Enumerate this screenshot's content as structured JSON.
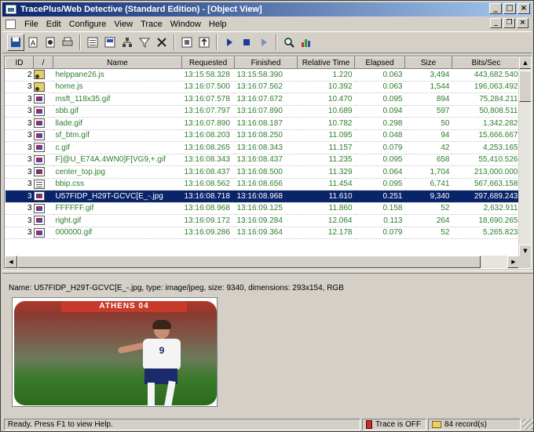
{
  "window": {
    "title": "TracePlus/Web Detective (Standard Edition) - [Object View]",
    "minimize": "_",
    "maximize": "□",
    "close": "×"
  },
  "menu": [
    "File",
    "Edit",
    "Configure",
    "View",
    "Trace",
    "Window",
    "Help"
  ],
  "mdi": {
    "minimize": "_",
    "restore": "❐",
    "close": "×"
  },
  "columns": [
    "ID",
    "/",
    "Name",
    "Requested",
    "Finished",
    "Relative Time",
    "Elapsed",
    "Size",
    "Bits/Sec"
  ],
  "rows": [
    {
      "id": "2",
      "icon": "js-icon",
      "type": "js",
      "name": "helppane26.js",
      "requested": "13:15:58.328",
      "finished": "13:15:58.390",
      "relative": "1.220",
      "elapsed": "0.063",
      "size": "3,494",
      "bps": "443,682.540"
    },
    {
      "id": "3",
      "icon": "js-icon",
      "type": "js",
      "name": "home.js",
      "requested": "13:16:07.500",
      "finished": "13:16:07.562",
      "relative": "10.392",
      "elapsed": "0.063",
      "size": "1,544",
      "bps": "196,063.492"
    },
    {
      "id": "3",
      "icon": "gif-icon",
      "type": "gif",
      "name": "msft_118x35.gif",
      "requested": "13:16:07.578",
      "finished": "13:16:07.672",
      "relative": "10.470",
      "elapsed": "0.095",
      "size": "894",
      "bps": "75,284.211"
    },
    {
      "id": "3",
      "icon": "gif-icon",
      "type": "gif",
      "name": "sbb.gif",
      "requested": "13:16:07.797",
      "finished": "13:16:07.890",
      "relative": "10.689",
      "elapsed": "0.094",
      "size": "597",
      "bps": "50,808.511"
    },
    {
      "id": "3",
      "icon": "gif-icon",
      "type": "gif",
      "name": "llade.gif",
      "requested": "13:16:07.890",
      "finished": "13:16:08.187",
      "relative": "10.782",
      "elapsed": "0.298",
      "size": "50",
      "bps": "1,342.282"
    },
    {
      "id": "3",
      "icon": "gif-icon",
      "type": "gif",
      "name": "sf_btm.gif",
      "requested": "13:16:08.203",
      "finished": "13:16:08.250",
      "relative": "11.095",
      "elapsed": "0.048",
      "size": "94",
      "bps": "15,666.667"
    },
    {
      "id": "3",
      "icon": "gif-icon",
      "type": "gif",
      "name": "c.gif",
      "requested": "13:16:08.265",
      "finished": "13:16:08.343",
      "relative": "11.157",
      "elapsed": "0.079",
      "size": "42",
      "bps": "4,253.165"
    },
    {
      "id": "3",
      "icon": "gif-icon",
      "type": "gif",
      "name": "F]@U_E74A.4WN0]F[VG9,+.gif",
      "requested": "13:16:08.343",
      "finished": "13:16:08.437",
      "relative": "11.235",
      "elapsed": "0.095",
      "size": "658",
      "bps": "55,410.526"
    },
    {
      "id": "3",
      "icon": "jpg-icon",
      "type": "jpg",
      "name": "center_top.jpg",
      "requested": "13:16:08.437",
      "finished": "13:16:08.500",
      "relative": "11.329",
      "elapsed": "0.064",
      "size": "1,704",
      "bps": "213,000.000"
    },
    {
      "id": "3",
      "icon": "css-icon",
      "type": "css",
      "name": "bbip.css",
      "requested": "13:16:08.562",
      "finished": "13:16:08.656",
      "relative": "11.454",
      "elapsed": "0.095",
      "size": "6,741",
      "bps": "567,663.158"
    },
    {
      "id": "3",
      "icon": "jpg-icon",
      "type": "jpg",
      "name": "U57FIDP_H29T-GCVC[E_-.jpg",
      "requested": "13:16:08.718",
      "finished": "13:16:08.968",
      "relative": "11.610",
      "elapsed": "0.251",
      "size": "9,340",
      "bps": "297,689.243",
      "selected": true
    },
    {
      "id": "3",
      "icon": "gif-icon",
      "type": "gif",
      "name": "FFFFFF.gif",
      "requested": "13:16:08.968",
      "finished": "13:16:09.125",
      "relative": "11.860",
      "elapsed": "0.158",
      "size": "52",
      "bps": "2,632.911"
    },
    {
      "id": "3",
      "icon": "gif-icon",
      "type": "gif",
      "name": "right.gif",
      "requested": "13:16:09.172",
      "finished": "13:16:09.284",
      "relative": "12.064",
      "elapsed": "0.113",
      "size": "264",
      "bps": "18,690.265"
    },
    {
      "id": "3",
      "icon": "gif-icon",
      "type": "gif",
      "name": "000000.gif",
      "requested": "13:16:09.286",
      "finished": "13:16:09.364",
      "relative": "12.178",
      "elapsed": "0.079",
      "size": "52",
      "bps": "5,265.823"
    }
  ],
  "detail": {
    "info": "Name: U57FIDP_H29T-GCVC[E_-.jpg, type: image/jpeg, size: 9340, dimensions: 293x154, RGB",
    "banner": "ATHENS 04",
    "jersey": "9"
  },
  "status": {
    "message": "Ready.  Press F1 to view Help.",
    "trace": "Trace is OFF",
    "records": "84 record(s)"
  }
}
